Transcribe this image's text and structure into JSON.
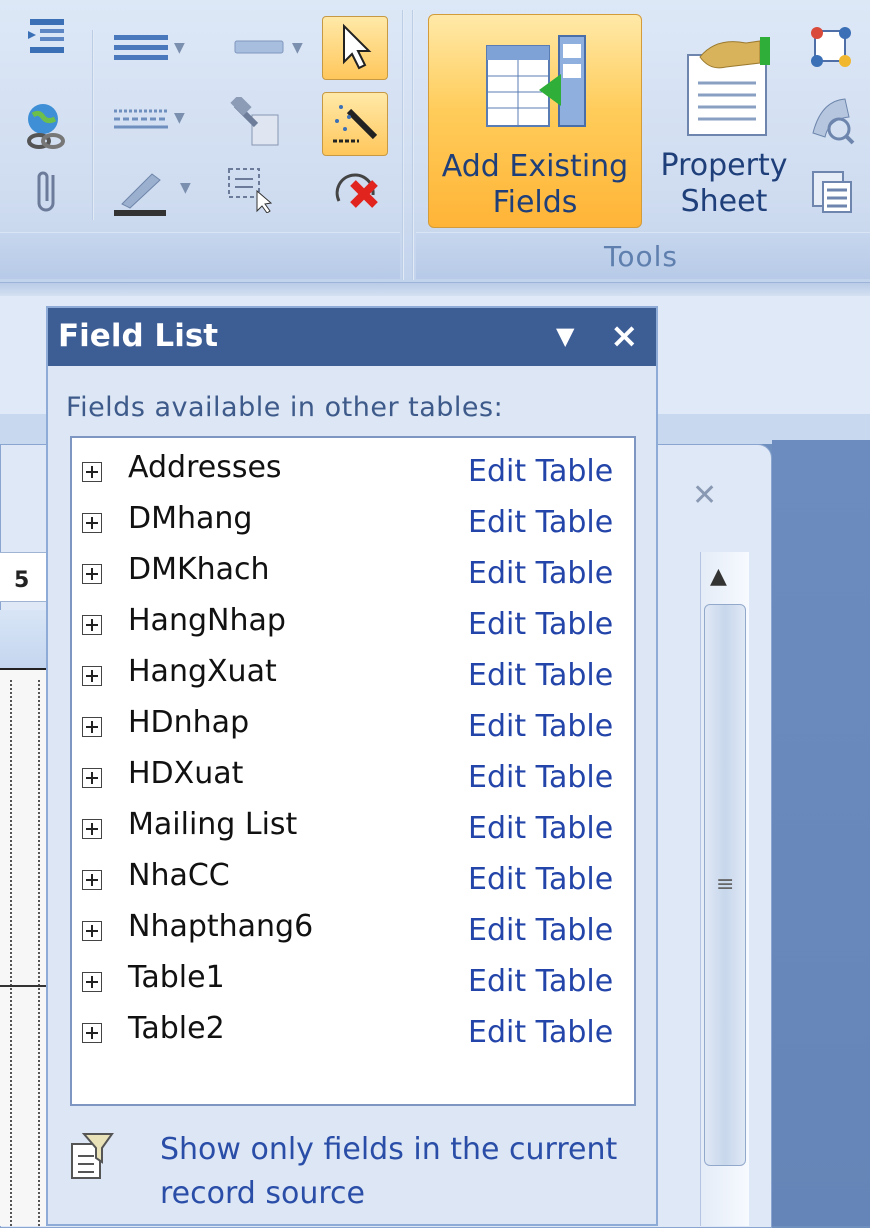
{
  "ribbon": {
    "buttons": {
      "add_existing_fields": {
        "line1": "Add Existing",
        "line2": "Fields"
      },
      "property_sheet": {
        "line1": "Property",
        "line2": "Sheet"
      }
    },
    "group_label": "Tools"
  },
  "field_list": {
    "title": "Field List",
    "available_label": "Fields available in other tables:",
    "tables": [
      {
        "name": "Addresses",
        "action": "Edit Table"
      },
      {
        "name": "DMhang",
        "action": "Edit Table"
      },
      {
        "name": "DMKhach",
        "action": "Edit Table"
      },
      {
        "name": "HangNhap",
        "action": "Edit Table"
      },
      {
        "name": "HangXuat",
        "action": "Edit Table"
      },
      {
        "name": "HDnhap",
        "action": "Edit Table"
      },
      {
        "name": "HDXuat",
        "action": "Edit Table"
      },
      {
        "name": "Mailing List",
        "action": "Edit Table"
      },
      {
        "name": "NhaCC",
        "action": "Edit Table"
      },
      {
        "name": "Nhapthang6",
        "action": "Edit Table"
      },
      {
        "name": "Table1",
        "action": "Edit Table"
      },
      {
        "name": "Table2",
        "action": "Edit Table"
      }
    ],
    "footer_link": "Show only fields in the current record source"
  },
  "ruler_number": "5",
  "colors": {
    "title_bar": "#3d5d95",
    "link": "#2344a9",
    "active_button": "#ffc75c"
  }
}
